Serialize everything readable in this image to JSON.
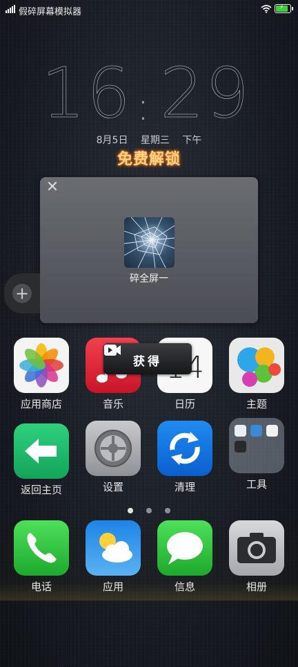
{
  "status_bar": {
    "title": "假碎屏幕模拟器",
    "icons": [
      "signal-icon",
      "wifi-icon",
      "battery-charging-icon"
    ]
  },
  "lock": {
    "hour": "16",
    "minute": "29",
    "date": "8月5日",
    "weekday": "星期三",
    "period": "下午",
    "headline": "免费解锁"
  },
  "popup": {
    "close_label": "✕",
    "app_name": "碎全屏一"
  },
  "fab": {
    "label": "+"
  },
  "tooltip": {
    "text": "获得"
  },
  "apps_row1": [
    {
      "label": "应用商店",
      "icon": "photos-icon"
    },
    {
      "label": "音乐",
      "icon": "music-icon"
    },
    {
      "label": "日历",
      "icon": "calendar-icon",
      "day": "14",
      "weekday": "三"
    },
    {
      "label": "主题",
      "icon": "theme-icon"
    }
  ],
  "apps_row2": [
    {
      "label": "返回主页",
      "icon": "back-arrow-icon"
    },
    {
      "label": "设置",
      "icon": "settings-icon"
    },
    {
      "label": "清理",
      "icon": "refresh-icon"
    },
    {
      "label": "工具",
      "icon": "folder-icon"
    }
  ],
  "dock": [
    {
      "label": "电话",
      "icon": "phone-icon"
    },
    {
      "label": "应用",
      "icon": "weather-icon"
    },
    {
      "label": "信息",
      "icon": "messages-icon"
    },
    {
      "label": "相册",
      "icon": "camera-icon"
    }
  ],
  "page_indicator": {
    "count": 3,
    "active": 1
  },
  "colors": {
    "headline": "#ffd48a",
    "battery": "#3ad33a"
  }
}
